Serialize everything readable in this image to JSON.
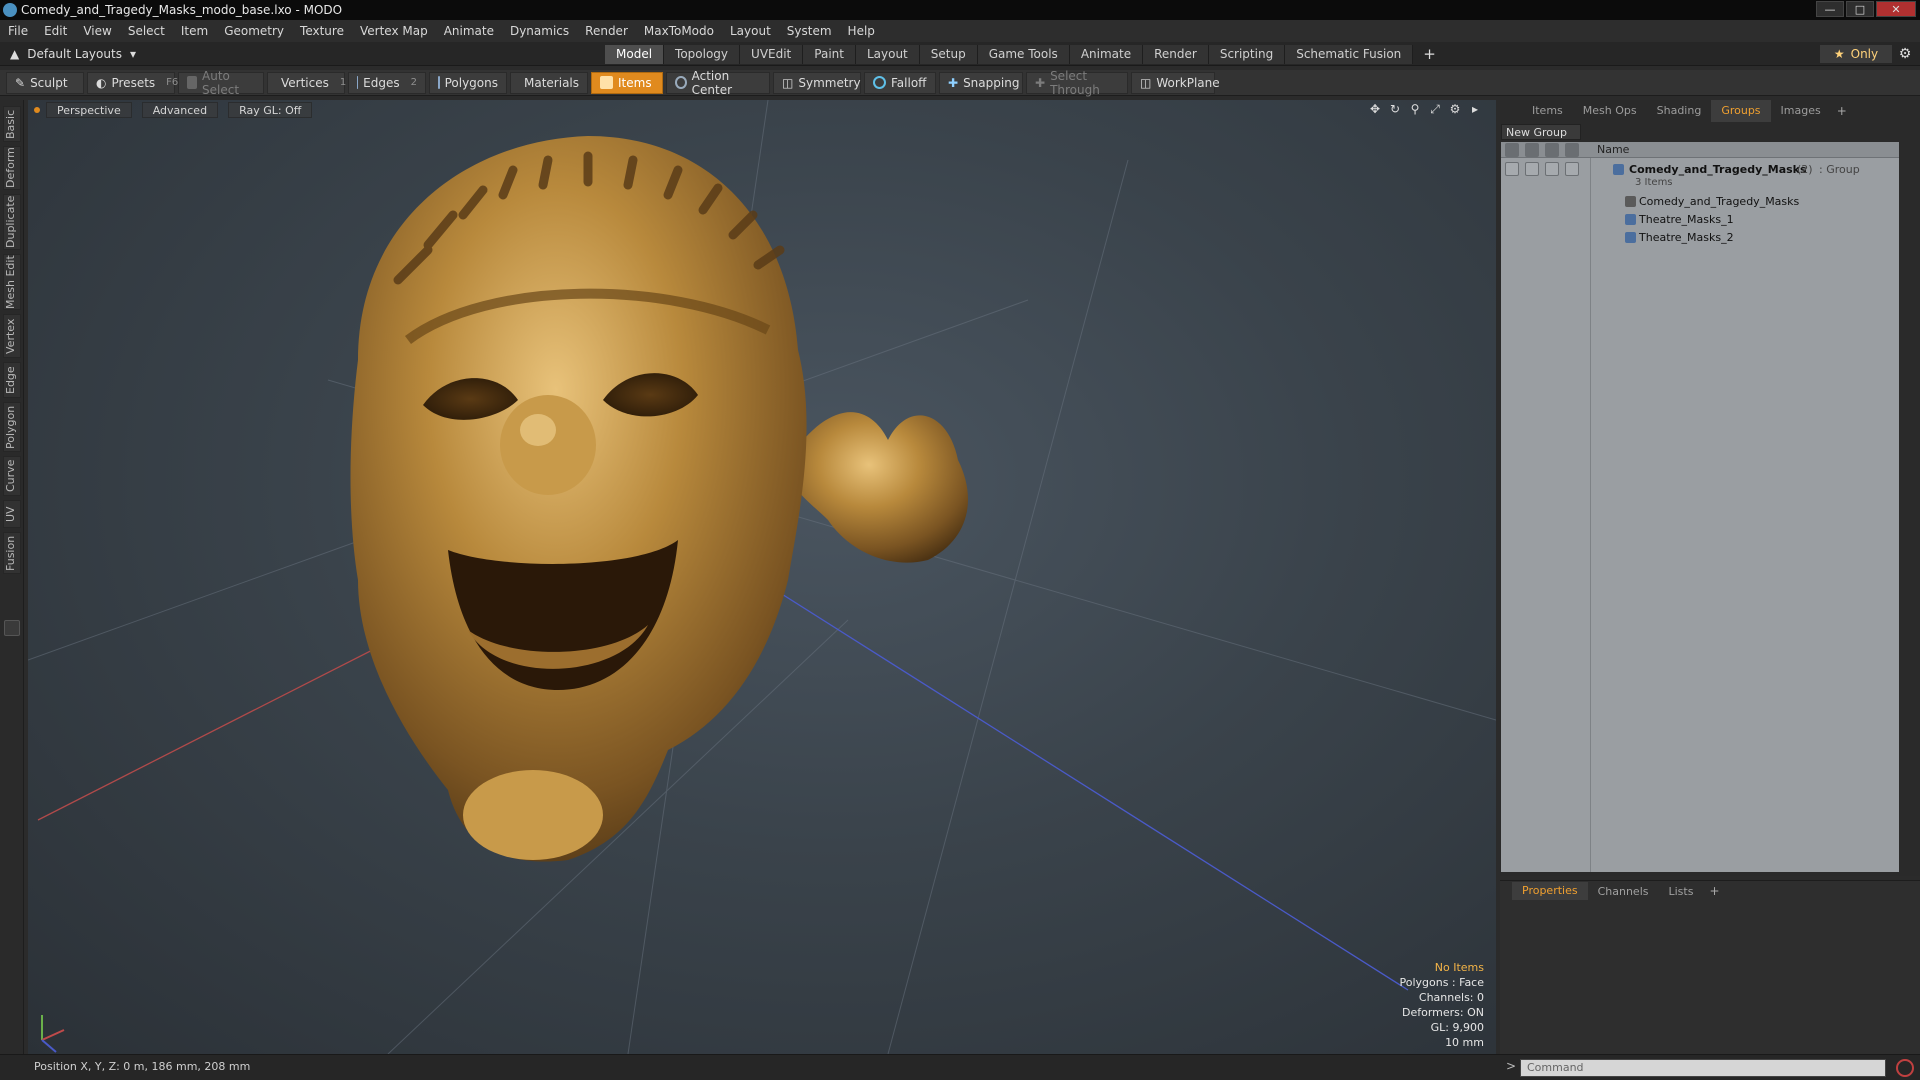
{
  "window": {
    "title": "Comedy_and_Tragedy_Masks_modo_base.lxo - MODO",
    "controls": [
      "—",
      "□",
      "✕"
    ]
  },
  "menu": [
    "File",
    "Edit",
    "View",
    "Select",
    "Item",
    "Geometry",
    "Texture",
    "Vertex Map",
    "Animate",
    "Dynamics",
    "Render",
    "MaxToModo",
    "Layout",
    "System",
    "Help"
  ],
  "layout": {
    "current": "Default Layouts",
    "tabs": [
      "Model",
      "Topology",
      "UVEdit",
      "Paint",
      "Layout",
      "Setup",
      "Game Tools",
      "Animate",
      "Render",
      "Scripting",
      "Schematic Fusion"
    ],
    "active_tab": "Model",
    "add_tab": "+",
    "only_label": "Only"
  },
  "toolbar": {
    "sculpt": "Sculpt",
    "presets": "Presets",
    "presets_key": "F6",
    "auto_select": "Auto Select",
    "vertices": "Vertices",
    "vertices_key": "1",
    "edges": "Edges",
    "edges_key": "2",
    "polygons": "Polygons",
    "materials": "Materials",
    "items": "Items",
    "action_center": "Action Center",
    "symmetry": "Symmetry",
    "falloff": "Falloff",
    "snapping": "Snapping",
    "select_through": "Select Through",
    "workplane": "WorkPlane"
  },
  "left_tabs": [
    "Basic",
    "Deform",
    "Duplicate",
    "Mesh Edit",
    "Vertex",
    "Edge",
    "Polygon",
    "Curve",
    "UV",
    "Fusion"
  ],
  "viewport": {
    "view": "Perspective",
    "shading": "Advanced",
    "raygl": "Ray GL: Off",
    "hud": {
      "no_items": "No Items",
      "polygons": "Polygons : Face",
      "channels": "Channels: 0",
      "deformers": "Deformers: ON",
      "gl": "GL: 9,900",
      "scale": "10 mm"
    }
  },
  "right_panel": {
    "tabs": [
      "Items",
      "Mesh Ops",
      "Shading",
      "Groups",
      "Images"
    ],
    "active_tab": "Groups",
    "add_tab": "+",
    "new_group": "New Group",
    "col_name": "Name",
    "group": {
      "name": "Comedy_and_Tragedy_Masks",
      "count": "(2)",
      "type": ": Group",
      "subtitle": "3 Items",
      "children": [
        "Comedy_and_Tragedy_Masks",
        "Theatre_Masks_1",
        "Theatre_Masks_2"
      ]
    }
  },
  "props_panel": {
    "tabs": [
      "Properties",
      "Channels",
      "Lists"
    ],
    "active_tab": "Properties",
    "add_tab": "+"
  },
  "status": {
    "position": "Position X, Y, Z:  0 m, 186 mm, 208 mm"
  },
  "command": {
    "placeholder": "Command"
  },
  "colors": {
    "accent": "#e08a1e",
    "viewport_bg": "#3a434b",
    "mask_gold": "#b8893c"
  }
}
